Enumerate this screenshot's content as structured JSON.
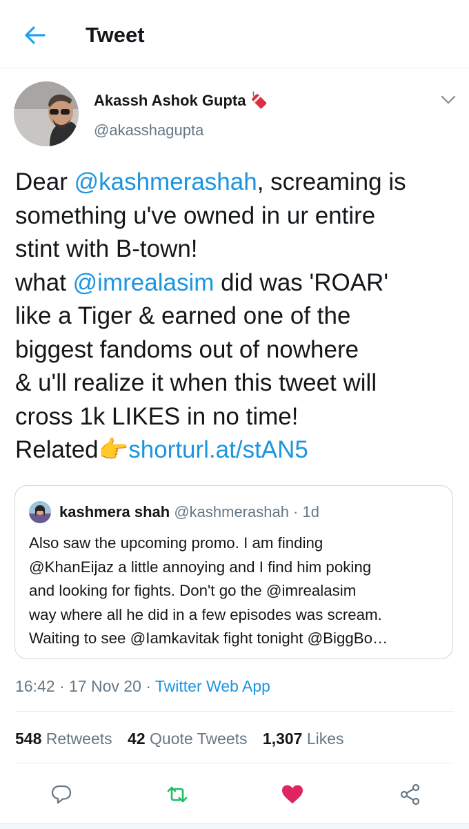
{
  "header": {
    "title": "Tweet",
    "back_icon": "arrow-left-icon",
    "accent": "#1da1f2"
  },
  "author": {
    "name": "Akassh Ashok Gupta",
    "handle": "@akasshagupta",
    "name_emoji": "firecracker-icon"
  },
  "tweet": {
    "lines": [
      [
        "Dear ",
        "@kashmerashah",
        ", screaming is"
      ],
      [
        "something u've owned in ur entire"
      ],
      [
        "stint with B-town!"
      ],
      [
        "what ",
        "@imrealasim",
        " did was 'ROAR'"
      ],
      [
        "like a Tiger & earned one of the"
      ],
      [
        "biggest fandoms out of nowhere"
      ],
      [
        "& u'll realize it when this tweet will"
      ],
      [
        "cross 1k LIKES in no time!"
      ],
      [
        "Related",
        "👉",
        "shorturl.at/stAN5"
      ]
    ],
    "text": {
      "l1a": "Dear ",
      "l1b": "@kashmerashah",
      "l1c": ", screaming is",
      "l2": "something u've owned in ur entire",
      "l3": "stint with B-town!",
      "l4a": "what ",
      "l4b": "@imrealasim",
      "l4c": " did was 'ROAR'",
      "l5": "like a Tiger & earned one of the",
      "l6": "biggest fandoms out of nowhere",
      "l7": "& u'll realize it when this tweet will",
      "l8": "cross 1k LIKES in no time!",
      "l9a": "Related",
      "l9b": "👉",
      "l9c": "shorturl.at/stAN5"
    },
    "link_color": "#1b95e0"
  },
  "quoted": {
    "name": "kashmera shah",
    "meta": " @kashmerashah · 1d",
    "lines": {
      "q1": "Also saw the upcoming promo. I am finding",
      "q2": "@KhanEijaz a little annoying and I find him poking",
      "q3": "and looking for fights. Don't go the @imrealasim",
      "q4": "way where all he did in a few episodes was scream.",
      "q5": "Waiting to see @Iamkavitak fight tonight @BiggBo…"
    }
  },
  "meta": {
    "time": "16:42",
    "sep1": " · ",
    "date": "17 Nov 20",
    "sep2": " · ",
    "client": "Twitter Web App"
  },
  "stats": {
    "retweets_count": "548",
    "retweets_label": " Retweets",
    "quotes_count": "42",
    "quotes_label": " Quote Tweets",
    "likes_count": "1,307",
    "likes_label": " Likes"
  },
  "actions": {
    "reply": "reply-icon",
    "retweet": "retweet-icon",
    "like": "heart-icon",
    "share": "share-icon",
    "retweet_color": "#17bf63",
    "like_color": "#e0245e",
    "icon_color": "#657786"
  }
}
